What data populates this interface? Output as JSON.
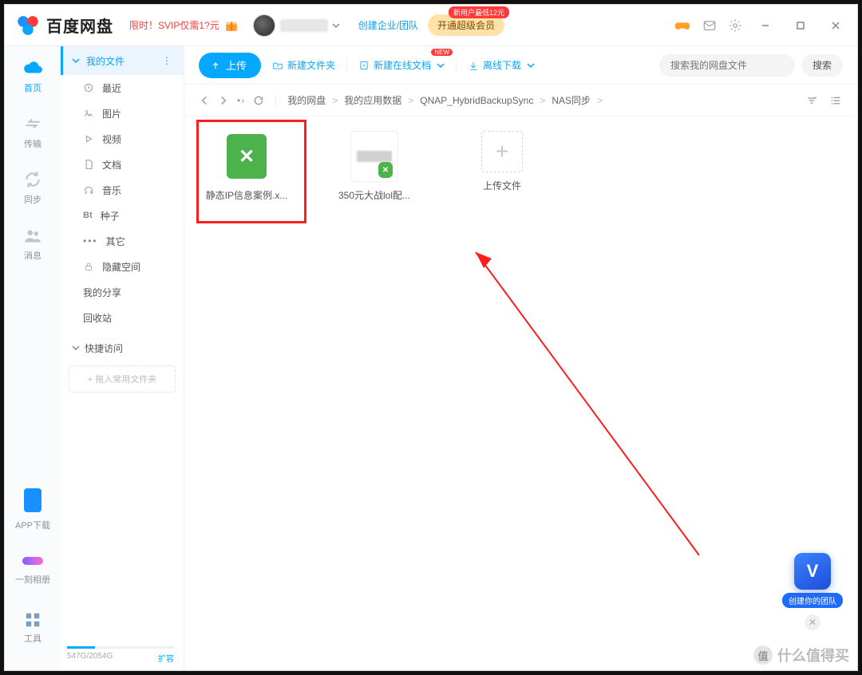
{
  "brand": "百度网盘",
  "titlebar": {
    "promo": "限时！SVIP仅需1?元",
    "team_link": "创建企业/团队",
    "vip_button": "开通超级会员",
    "vip_badge": "新用户最低12元"
  },
  "rail": {
    "home": "首页",
    "transfer": "传输",
    "sync": "同步",
    "messages": "消息",
    "app_download": "APP下载",
    "moments": "一刻相册",
    "tools": "工具"
  },
  "sidebar": {
    "my_files": "我的文件",
    "items": {
      "recent": "最近",
      "images": "图片",
      "videos": "视频",
      "documents": "文档",
      "music": "音乐",
      "seeds_prefix": "Bt",
      "seeds": "种子",
      "other": "其它",
      "hidden": "隐藏空间"
    },
    "my_share": "我的分享",
    "recycle": "回收站",
    "quick_access": "快捷访问",
    "drop_hint": "+ 拖入常用文件夹"
  },
  "toolbar": {
    "upload": "上传",
    "new_folder": "新建文件夹",
    "new_online_doc": "新建在线文档",
    "new_tag": "NEW",
    "offline_download": "离线下载",
    "search_placeholder": "搜索我的网盘文件",
    "search_button": "搜索"
  },
  "breadcrumb": {
    "items": [
      "我的网盘",
      "我的应用数据",
      "QNAP_HybridBackupSync",
      "NAS同步"
    ]
  },
  "files": {
    "item1": "静态IP信息案例.x...",
    "item2": "350元大战lol配...",
    "upload_tile": "上传文件"
  },
  "storage": {
    "used": "547G/2054G",
    "expand": "扩容"
  },
  "team_float": {
    "letter": "V",
    "label": "创建你的团队"
  },
  "watermark": "什么值得买"
}
